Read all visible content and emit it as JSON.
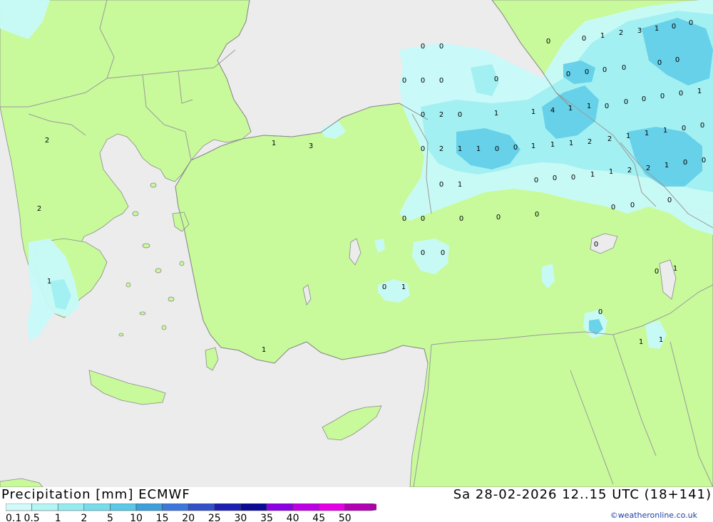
{
  "header": {
    "product": "Precipitation [mm] ECMWF",
    "valid_time": "Sa 28-02-2026 12..15 UTC (18+141)"
  },
  "credit": "©weatheronline.co.uk",
  "legend": {
    "labels": [
      "0.1",
      "0.5",
      "1",
      "2",
      "5",
      "10",
      "15",
      "20",
      "25",
      "30",
      "35",
      "40",
      "45",
      "50"
    ],
    "colors": [
      "#d2fafa",
      "#b4f5f5",
      "#96ebf0",
      "#78dceb",
      "#5ac8e6",
      "#3ca0dc",
      "#3c78dc",
      "#3250c8",
      "#1e1eb4",
      "#0a0a96",
      "#8c00e6",
      "#be00e6",
      "#e600e6",
      "#b400b4",
      "#aa00aa"
    ]
  },
  "colors": {
    "land": "#c8fa9b",
    "sea": "#ececec",
    "precip_light": "#c8fafa",
    "precip_mid": "#9eeef2",
    "precip_heavy": "#5fcde8"
  },
  "map_values": [
    "0",
    "0",
    "0",
    "0",
    "0",
    "0",
    "2",
    "0",
    "0",
    "1",
    "1",
    "4",
    "1",
    "1",
    "0",
    "0",
    "0",
    "0",
    "0",
    "1",
    "2",
    "1",
    "0",
    "1",
    "1",
    "0",
    "0",
    "1",
    "1",
    "2",
    "2",
    "1",
    "1",
    "1",
    "0",
    "0",
    "0",
    "1",
    "1",
    "1",
    "2",
    "2",
    "1",
    "0",
    "0",
    "0",
    "0",
    "0",
    "0",
    "0",
    "0",
    "0",
    "0",
    "0",
    "0",
    "0",
    "0",
    "0",
    "0",
    "1",
    "0",
    "0",
    "1",
    "0",
    "1",
    "1",
    "1",
    "2",
    "2",
    "1",
    "3",
    "1",
    "0",
    "0",
    "1",
    "2",
    "3",
    "1",
    "0",
    "0",
    "0",
    "0",
    "0",
    "0",
    "0",
    "0"
  ]
}
